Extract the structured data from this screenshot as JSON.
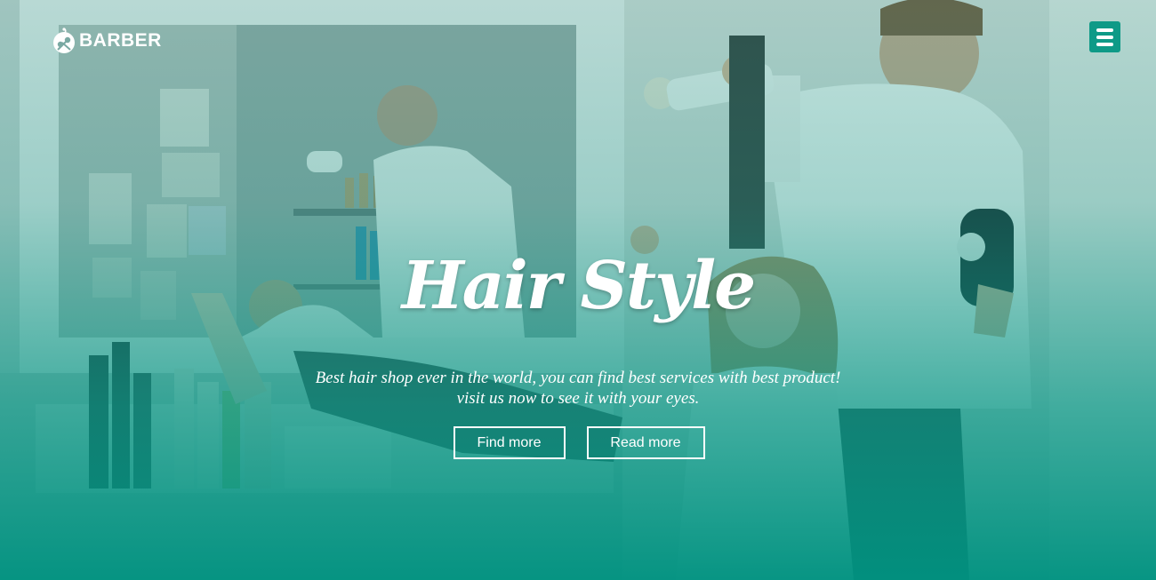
{
  "header": {
    "brand_name": "BARBER",
    "brand_icon": "barber-scissors-icon",
    "menu_icon": "hamburger-menu-icon"
  },
  "hero": {
    "title": "Hair Style",
    "subtitle_line1": "Best hair shop ever in the world, you can find best services with best product!",
    "subtitle_line2": "visit us now to see it with your eyes.",
    "find_more_label": "Find more",
    "read_more_label": "Read more"
  },
  "colors": {
    "accent": "#0e9a87",
    "overlay_bottom": "#009280",
    "text": "#ffffff"
  }
}
